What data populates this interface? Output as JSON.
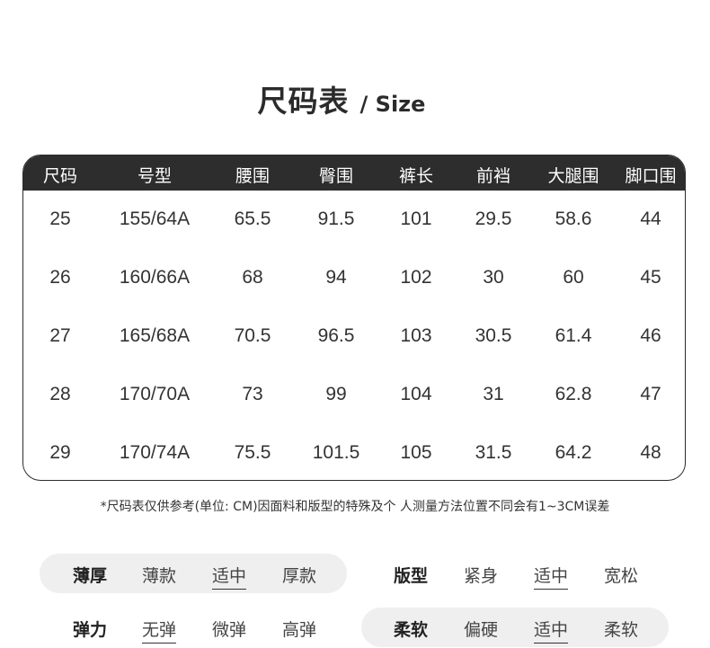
{
  "title": {
    "cn": "尺码表",
    "en": "/ Size"
  },
  "table": {
    "headers": [
      "尺码",
      "号型",
      "腰围",
      "臀围",
      "裤长",
      "前裆",
      "大腿围",
      "脚口围"
    ],
    "rows": [
      [
        "25",
        "155/64A",
        "65.5",
        "91.5",
        "101",
        "29.5",
        "58.6",
        "44"
      ],
      [
        "26",
        "160/66A",
        "68",
        "94",
        "102",
        "30",
        "60",
        "45"
      ],
      [
        "27",
        "165/68A",
        "70.5",
        "96.5",
        "103",
        "30.5",
        "61.4",
        "46"
      ],
      [
        "28",
        "170/70A",
        "73",
        "99",
        "104",
        "31",
        "62.8",
        "47"
      ],
      [
        "29",
        "170/74A",
        "75.5",
        "101.5",
        "105",
        "31.5",
        "64.2",
        "48"
      ]
    ]
  },
  "note": "*尺码表仅供参考(单位: CM)因面料和版型的特殊及个 人测量方法位置不同会有1~3CM误差",
  "attributes": {
    "thickness": {
      "label": "薄厚",
      "options": [
        "薄款",
        "适中",
        "厚款"
      ],
      "selected": "适中"
    },
    "fit": {
      "label": "版型",
      "options": [
        "紧身",
        "适中",
        "宽松"
      ],
      "selected": "适中"
    },
    "elasticity": {
      "label": "弹力",
      "options": [
        "无弹",
        "微弹",
        "高弹"
      ],
      "selected": "无弹"
    },
    "softness": {
      "label": "柔软",
      "options": [
        "偏硬",
        "适中",
        "柔软"
      ],
      "selected": "适中"
    }
  },
  "colors": {
    "header_bg": "#2d2d2d",
    "pill_bg": "#efefef",
    "text": "#2b2b2b"
  }
}
